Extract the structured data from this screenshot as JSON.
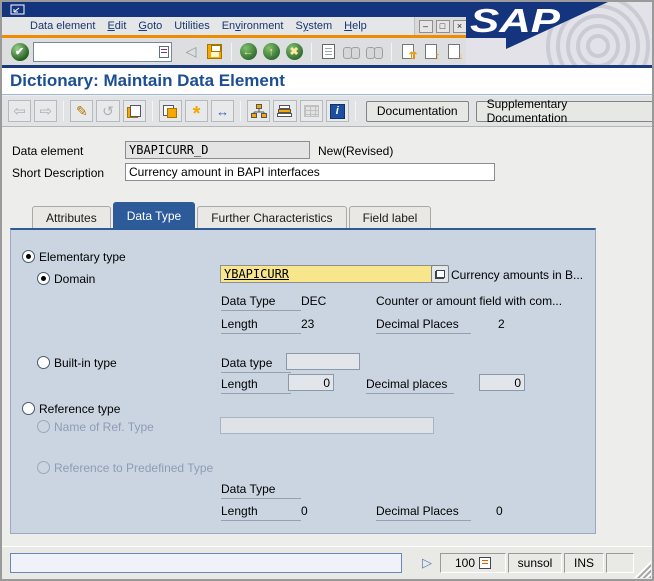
{
  "menu_bar": {
    "items": [
      {
        "pre": "Data element",
        "key": "",
        "post": ""
      },
      {
        "pre": "",
        "key": "E",
        "post": "dit"
      },
      {
        "pre": "",
        "key": "G",
        "post": "oto"
      },
      {
        "pre": "Utilities",
        "key": "",
        "post": ""
      },
      {
        "pre": "En",
        "key": "v",
        "post": "ironment"
      },
      {
        "pre": "S",
        "key": "y",
        "post": "stem"
      },
      {
        "pre": "",
        "key": "H",
        "post": "elp"
      }
    ]
  },
  "window_controls": {
    "minimize": "–",
    "maximize": "□",
    "close": "×"
  },
  "logo": {
    "text": "SAP"
  },
  "toolbar": {
    "command_value": "",
    "icon_glyphs": {
      "enter": "✔",
      "collapse": "◁",
      "back": "←",
      "exit": "↑",
      "cancel": "✖",
      "first_page": "⇈",
      "page_up": "↑",
      "page_down": "↓",
      "last_page": "⇊"
    }
  },
  "screen_title": "Dictionary: Maintain Data Element",
  "app_toolbar": {
    "icon_glyphs": {
      "previous": "⇦",
      "next": "⇨",
      "change": "✎",
      "refresh": "↺",
      "spark": "*",
      "check_arrows": "↔",
      "info": "i"
    },
    "documentation": "Documentation",
    "supplementary": "Supplementary Documentation"
  },
  "header_fields": {
    "data_element_label": "Data element",
    "data_element_value": "YBAPICURR_D",
    "status_text": "New(Revised)",
    "short_desc_label": "Short Description",
    "short_desc_value": "Currency amount in BAPI interfaces"
  },
  "tabs": {
    "items": [
      {
        "label": "Attributes"
      },
      {
        "label": "Data Type"
      },
      {
        "label": "Further Characteristics"
      },
      {
        "label": "Field label"
      }
    ]
  },
  "panel": {
    "elementary_type": "Elementary type",
    "domain_label": "Domain",
    "domain_value": "YBAPICURR",
    "domain_short_text": "Currency amounts in B...",
    "data_type_label": "Data Type",
    "data_type_value": "DEC",
    "data_type_desc": "Counter or amount field with com...",
    "length_label": "Length",
    "length_value": "23",
    "decimals_label": "Decimal Places",
    "decimals_value": "2",
    "builtin_label": "Built-in type",
    "builtin_data_type_label": "Data type",
    "builtin_data_type_value": "",
    "builtin_length_label": "Length",
    "builtin_length_value": "0",
    "builtin_decimals_label": "Decimal places",
    "builtin_decimals_value": "0",
    "reference_label": "Reference type",
    "ref_name_label": "Name of Ref. Type",
    "ref_name_value": "",
    "ref_predef_label": "Reference to Predefined Type",
    "ref_data_type_label": "Data Type",
    "ref_data_type_value": "",
    "ref_length_label": "Length",
    "ref_length_value": "0",
    "ref_decimals_label": "Decimal Places",
    "ref_decimals_value": "0"
  },
  "status_bar": {
    "expand_arrow": "▷",
    "session": "100",
    "system_name": "sunsol",
    "mode": "INS"
  }
}
